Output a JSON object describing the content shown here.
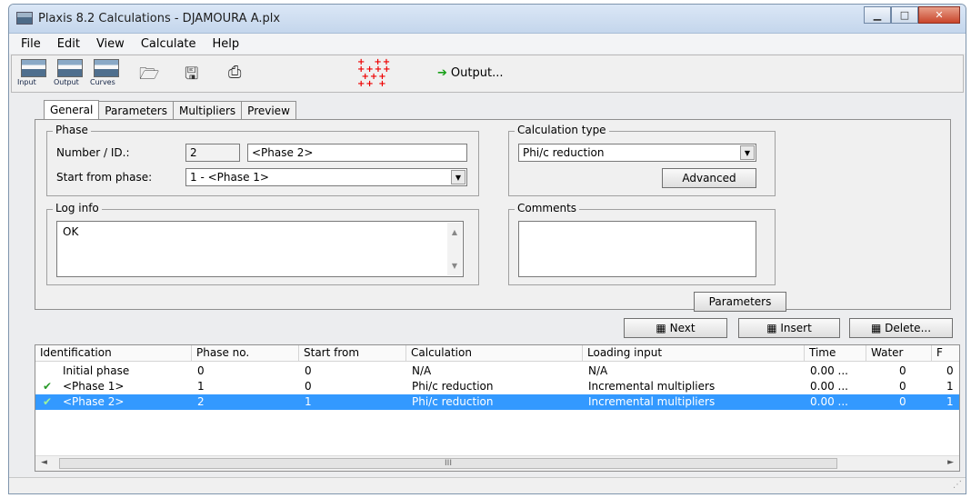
{
  "window": {
    "title": "Plaxis 8.2 Calculations - DJAMOURA A.plx"
  },
  "menu": [
    "File",
    "Edit",
    "View",
    "Calculate",
    "Help"
  ],
  "toolbar": {
    "input": "Input",
    "output": "Output",
    "curves": "Curves",
    "output_button": "Output..."
  },
  "tabs": [
    "General",
    "Parameters",
    "Multipliers",
    "Preview"
  ],
  "phase": {
    "title": "Phase",
    "number_label": "Number / ID.:",
    "number": "2",
    "id": "<Phase 2>",
    "start_label": "Start from phase:",
    "start_value": "1 - <Phase 1>"
  },
  "calc_type": {
    "title": "Calculation type",
    "value": "Phi/c reduction",
    "advanced": "Advanced"
  },
  "log_info": {
    "title": "Log info",
    "text": "OK"
  },
  "comments": {
    "title": "Comments",
    "text": ""
  },
  "parameters_button": "Parameters",
  "actions": {
    "next": "Next",
    "insert": "Insert",
    "delete": "Delete..."
  },
  "table": {
    "headers": [
      "Identification",
      "Phase no.",
      "Start from",
      "Calculation",
      "Loading input",
      "Time",
      "Water",
      "F"
    ],
    "rows": [
      {
        "id": "Initial phase",
        "no": "0",
        "start": "0",
        "calc": "N/A",
        "loading": "N/A",
        "time": "0.00 ...",
        "water": "0",
        "f": "0"
      },
      {
        "id": "<Phase 1>",
        "no": "1",
        "start": "0",
        "calc": "Phi/c reduction",
        "loading": "Incremental multipliers",
        "time": "0.00 ...",
        "water": "0",
        "f": "1"
      },
      {
        "id": "<Phase 2>",
        "no": "2",
        "start": "1",
        "calc": "Phi/c reduction",
        "loading": "Incremental multipliers",
        "time": "0.00 ...",
        "water": "0",
        "f": "1"
      }
    ]
  },
  "scroll_center": "III"
}
